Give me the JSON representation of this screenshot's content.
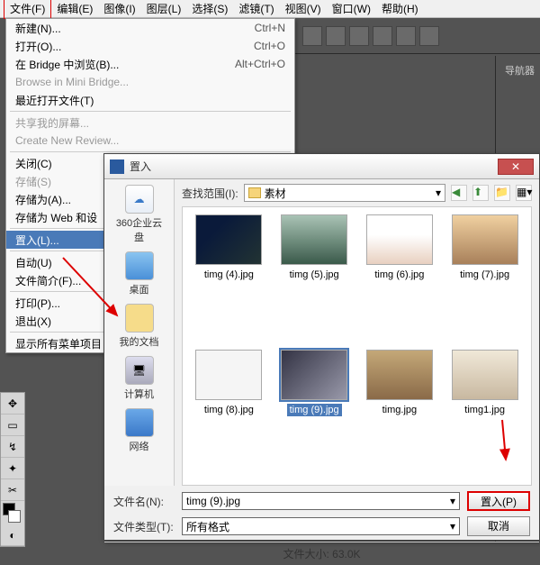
{
  "menubar": [
    "文件(F)",
    "编辑(E)",
    "图像(I)",
    "图层(L)",
    "选择(S)",
    "滤镜(T)",
    "视图(V)",
    "窗口(W)",
    "帮助(H)"
  ],
  "dropdown": {
    "groups": [
      [
        {
          "label": "新建(N)...",
          "shortcut": "Ctrl+N"
        },
        {
          "label": "打开(O)...",
          "shortcut": "Ctrl+O"
        },
        {
          "label": "在 Bridge 中浏览(B)...",
          "shortcut": "Alt+Ctrl+O"
        },
        {
          "label": "Browse in Mini Bridge...",
          "shortcut": "",
          "disabled": true
        },
        {
          "label": "最近打开文件(T)",
          "shortcut": ""
        }
      ],
      [
        {
          "label": "共享我的屏幕...",
          "shortcut": "",
          "disabled": true
        },
        {
          "label": "Create New Review...",
          "shortcut": "",
          "disabled": true
        }
      ],
      [
        {
          "label": "关闭(C)",
          "shortcut": ""
        },
        {
          "label": "存储(S)",
          "shortcut": "",
          "disabled": true
        },
        {
          "label": "存储为(A)...",
          "shortcut": ""
        },
        {
          "label": "存储为 Web 和设",
          "shortcut": ""
        }
      ],
      [
        {
          "label": "置入(L)...",
          "shortcut": "",
          "highlight": true
        }
      ],
      [
        {
          "label": "自动(U)",
          "shortcut": ""
        },
        {
          "label": "文件简介(F)...",
          "shortcut": ""
        }
      ],
      [
        {
          "label": "打印(P)...",
          "shortcut": ""
        },
        {
          "label": "退出(X)",
          "shortcut": ""
        }
      ],
      [
        {
          "label": "显示所有菜单项目",
          "shortcut": ""
        }
      ]
    ]
  },
  "nav_panel": "导航器",
  "dialog": {
    "title": "置入",
    "lookup_label": "查找范围(I):",
    "lookup_value": "素材",
    "sidebar": [
      {
        "label": "360企业云盘",
        "ico": "sbc1",
        "glyph": "☁"
      },
      {
        "label": "桌面",
        "ico": "sbc2",
        "glyph": ""
      },
      {
        "label": "我的文档",
        "ico": "sbc3",
        "glyph": ""
      },
      {
        "label": "计算机",
        "ico": "sbc4",
        "glyph": "🖥"
      },
      {
        "label": "网络",
        "ico": "sbc5",
        "glyph": ""
      }
    ],
    "files": [
      {
        "name": "timg (4).jpg",
        "th": "th1"
      },
      {
        "name": "timg (5).jpg",
        "th": "th2"
      },
      {
        "name": "timg (6).jpg",
        "th": "th3"
      },
      {
        "name": "timg (7).jpg",
        "th": "th4"
      },
      {
        "name": "timg (8).jpg",
        "th": "th5"
      },
      {
        "name": "timg (9).jpg",
        "th": "th6",
        "selected": true
      },
      {
        "name": "timg.jpg",
        "th": "th7"
      },
      {
        "name": "timg1.jpg",
        "th": "th8"
      }
    ],
    "filename_label": "文件名(N):",
    "filename_value": "timg (9).jpg",
    "filetype_label": "文件类型(T):",
    "filetype_value": "所有格式",
    "btn_place": "置入(P)",
    "btn_cancel": "取消",
    "filesize_label": "文件大小:",
    "filesize_value": "63.0K"
  }
}
